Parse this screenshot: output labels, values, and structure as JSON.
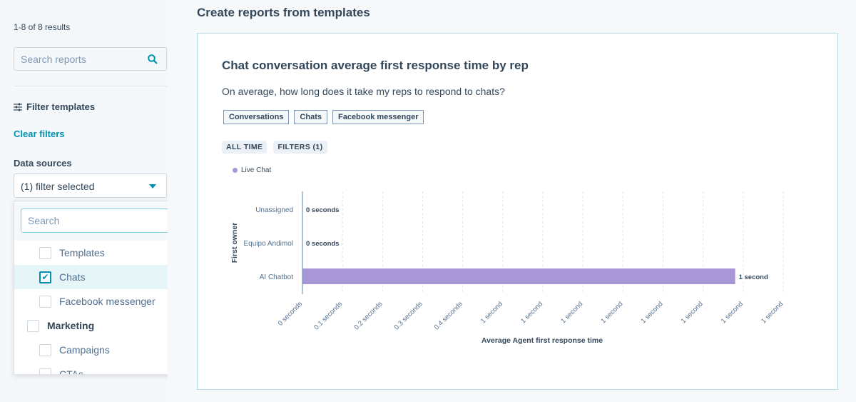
{
  "sidebar": {
    "results": "1-8 of 8 results",
    "search_placeholder": "Search reports",
    "filter_heading": "Filter templates",
    "clear_filters": "Clear filters",
    "data_sources_label": "Data sources",
    "data_sources_value": "(1) filter selected",
    "dropdown": {
      "search_placeholder": "Search",
      "items": [
        {
          "label": "Templates",
          "checked": false
        },
        {
          "label": "Chats",
          "checked": true
        },
        {
          "label": "Facebook messenger",
          "checked": false
        },
        {
          "label": "Marketing",
          "checked": false,
          "group": true
        },
        {
          "label": "Campaigns",
          "checked": false
        },
        {
          "label": "CTAs",
          "checked": false
        }
      ]
    }
  },
  "main": {
    "title": "Create reports from templates",
    "card": {
      "title": "Chat conversation average first response time by rep",
      "subtitle": "On average, how long does it take my reps to respond to chats?",
      "tags": [
        "Conversations",
        "Chats",
        "Facebook messenger"
      ],
      "pills": [
        "ALL TIME",
        "FILTERS (1)"
      ]
    }
  },
  "chart_data": {
    "type": "bar",
    "orientation": "horizontal",
    "xlabel": "Average Agent first response time",
    "ylabel": "First owner",
    "categories": [
      "Unassigned",
      "Equipo Andimol",
      "AI Chatbot"
    ],
    "series": [
      {
        "name": "Live Chat",
        "values": [
          0,
          0,
          1.08
        ],
        "color": "#a897d6"
      }
    ],
    "data_labels": [
      "0 seconds",
      "0 seconds",
      "1 second"
    ],
    "x_ticks": [
      "0 seconds",
      "0.1 seconds",
      "0.2 seconds",
      "0.3 seconds",
      "0.4 seconds",
      "1 second",
      "1 second",
      "1 second",
      "1 second",
      "1 second",
      "1 second",
      "1 second",
      "1 second"
    ],
    "xlim": [
      0,
      1.2
    ],
    "grid": true,
    "legend": "top-left"
  }
}
